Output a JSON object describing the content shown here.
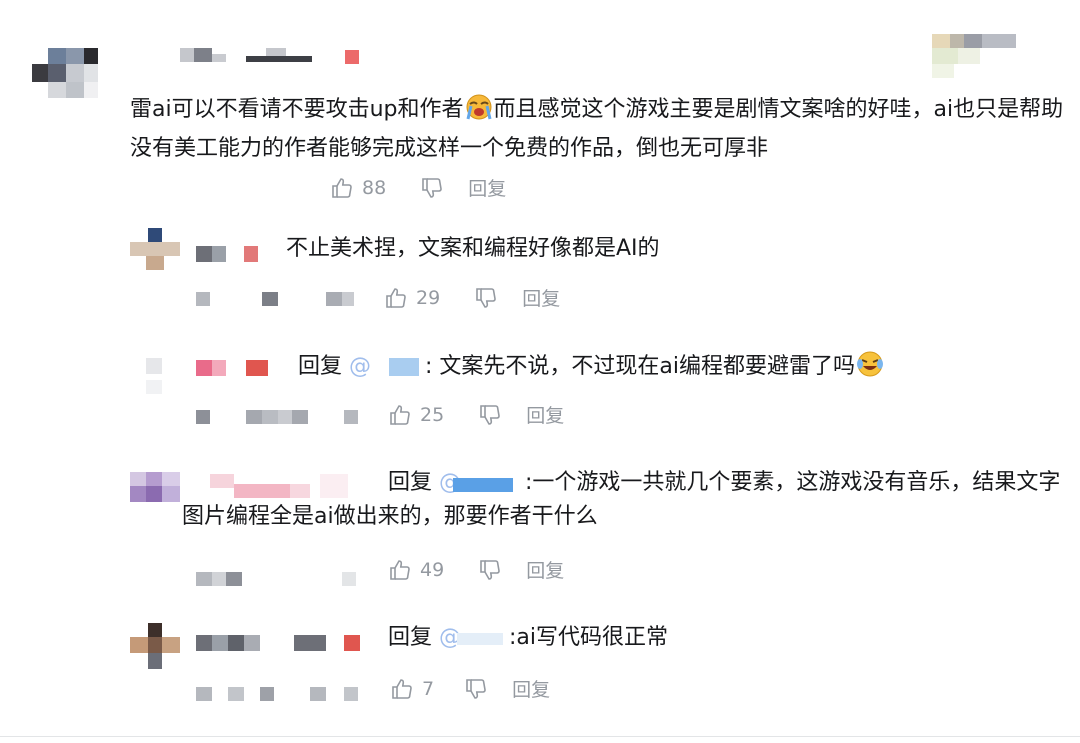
{
  "comments": [
    {
      "text_before_emoji": "雷ai可以不看请不要攻击up和作者",
      "text_after_emoji": "而且感觉这个游戏主要是剧情文案啥的好哇，ai也只是帮助没有美工能力的作者能够完成这样一个免费的作品，倒也无可厚非",
      "likes": "88",
      "reply_label": "回复"
    }
  ],
  "replies": [
    {
      "text": "不止美术捏，文案和编程好像都是AI的",
      "likes": "29",
      "reply_label": "回复"
    },
    {
      "prefix": "回复",
      "mention": "@",
      "text": ": 文案先不说，不过现在ai编程都要避雷了吗",
      "likes": "25",
      "reply_label": "回复"
    },
    {
      "prefix": "回复",
      "mention": "@",
      "text": ":一个游戏一共就几个要素，这游戏没有音乐，结果文字图片编程全是ai做出来的，那要作者干什么",
      "likes": "49",
      "reply_label": "回复"
    },
    {
      "prefix": "回复",
      "mention": "@",
      "text": ":ai写代码很正常",
      "likes": "7",
      "reply_label": "回复"
    }
  ],
  "colors": {
    "text": "#18191c",
    "muted": "#9499a0",
    "mention": "#2f6fd6"
  },
  "icons": {
    "like": "thumb-up-icon",
    "dislike": "thumb-down-icon"
  }
}
